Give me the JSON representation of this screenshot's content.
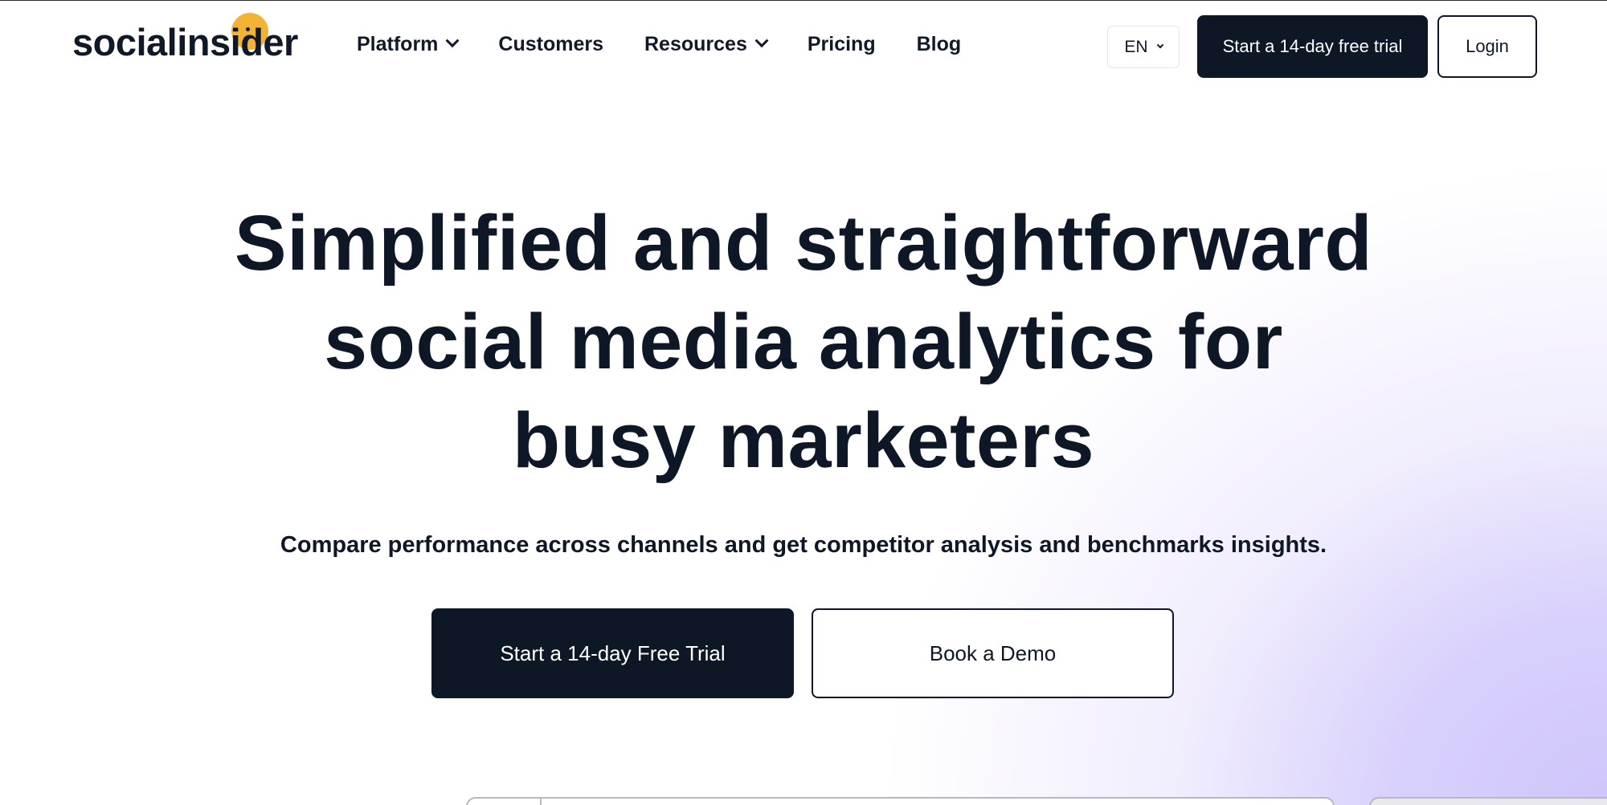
{
  "header": {
    "logo_text": "socialinsider",
    "nav": [
      {
        "label": "Platform",
        "has_dropdown": true
      },
      {
        "label": "Customers",
        "has_dropdown": false
      },
      {
        "label": "Resources",
        "has_dropdown": true
      },
      {
        "label": "Pricing",
        "has_dropdown": false
      },
      {
        "label": "Blog",
        "has_dropdown": false
      }
    ],
    "language": "EN",
    "trial_button": "Start a 14-day free trial",
    "login_button": "Login"
  },
  "hero": {
    "title_lines": [
      "Simplified and straightforward",
      "social media analytics for",
      "busy marketers"
    ],
    "subtitle": "Compare performance across channels and get competitor analysis and benchmarks insights.",
    "primary_cta": "Start a 14-day Free Trial",
    "secondary_cta": "Book a Demo"
  },
  "colors": {
    "brand_dark": "#0e1726",
    "logo_accent": "#f5b335",
    "gradient_accent": "#cfc5fb"
  },
  "icons": {
    "dropdown": "chevron-down-icon"
  }
}
